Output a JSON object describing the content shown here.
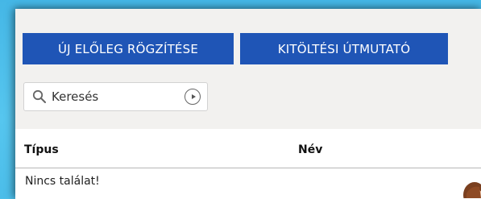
{
  "toolbar": {
    "new_advance_label": "ÚJ ELŐLEG RÖGZÍTÉSE",
    "guide_label": "KITÖLTÉSI ÚTMUTATÓ"
  },
  "search": {
    "placeholder": "Keresés",
    "icon": "search-icon",
    "submit_icon": "play-circle-icon"
  },
  "table": {
    "columns": [
      "Típus",
      "Név"
    ],
    "empty_message": "Nincs találat!"
  },
  "colors": {
    "background": "#4fbfe8",
    "panel": "#f2f1ef",
    "primary_button": "#1f55b6"
  }
}
